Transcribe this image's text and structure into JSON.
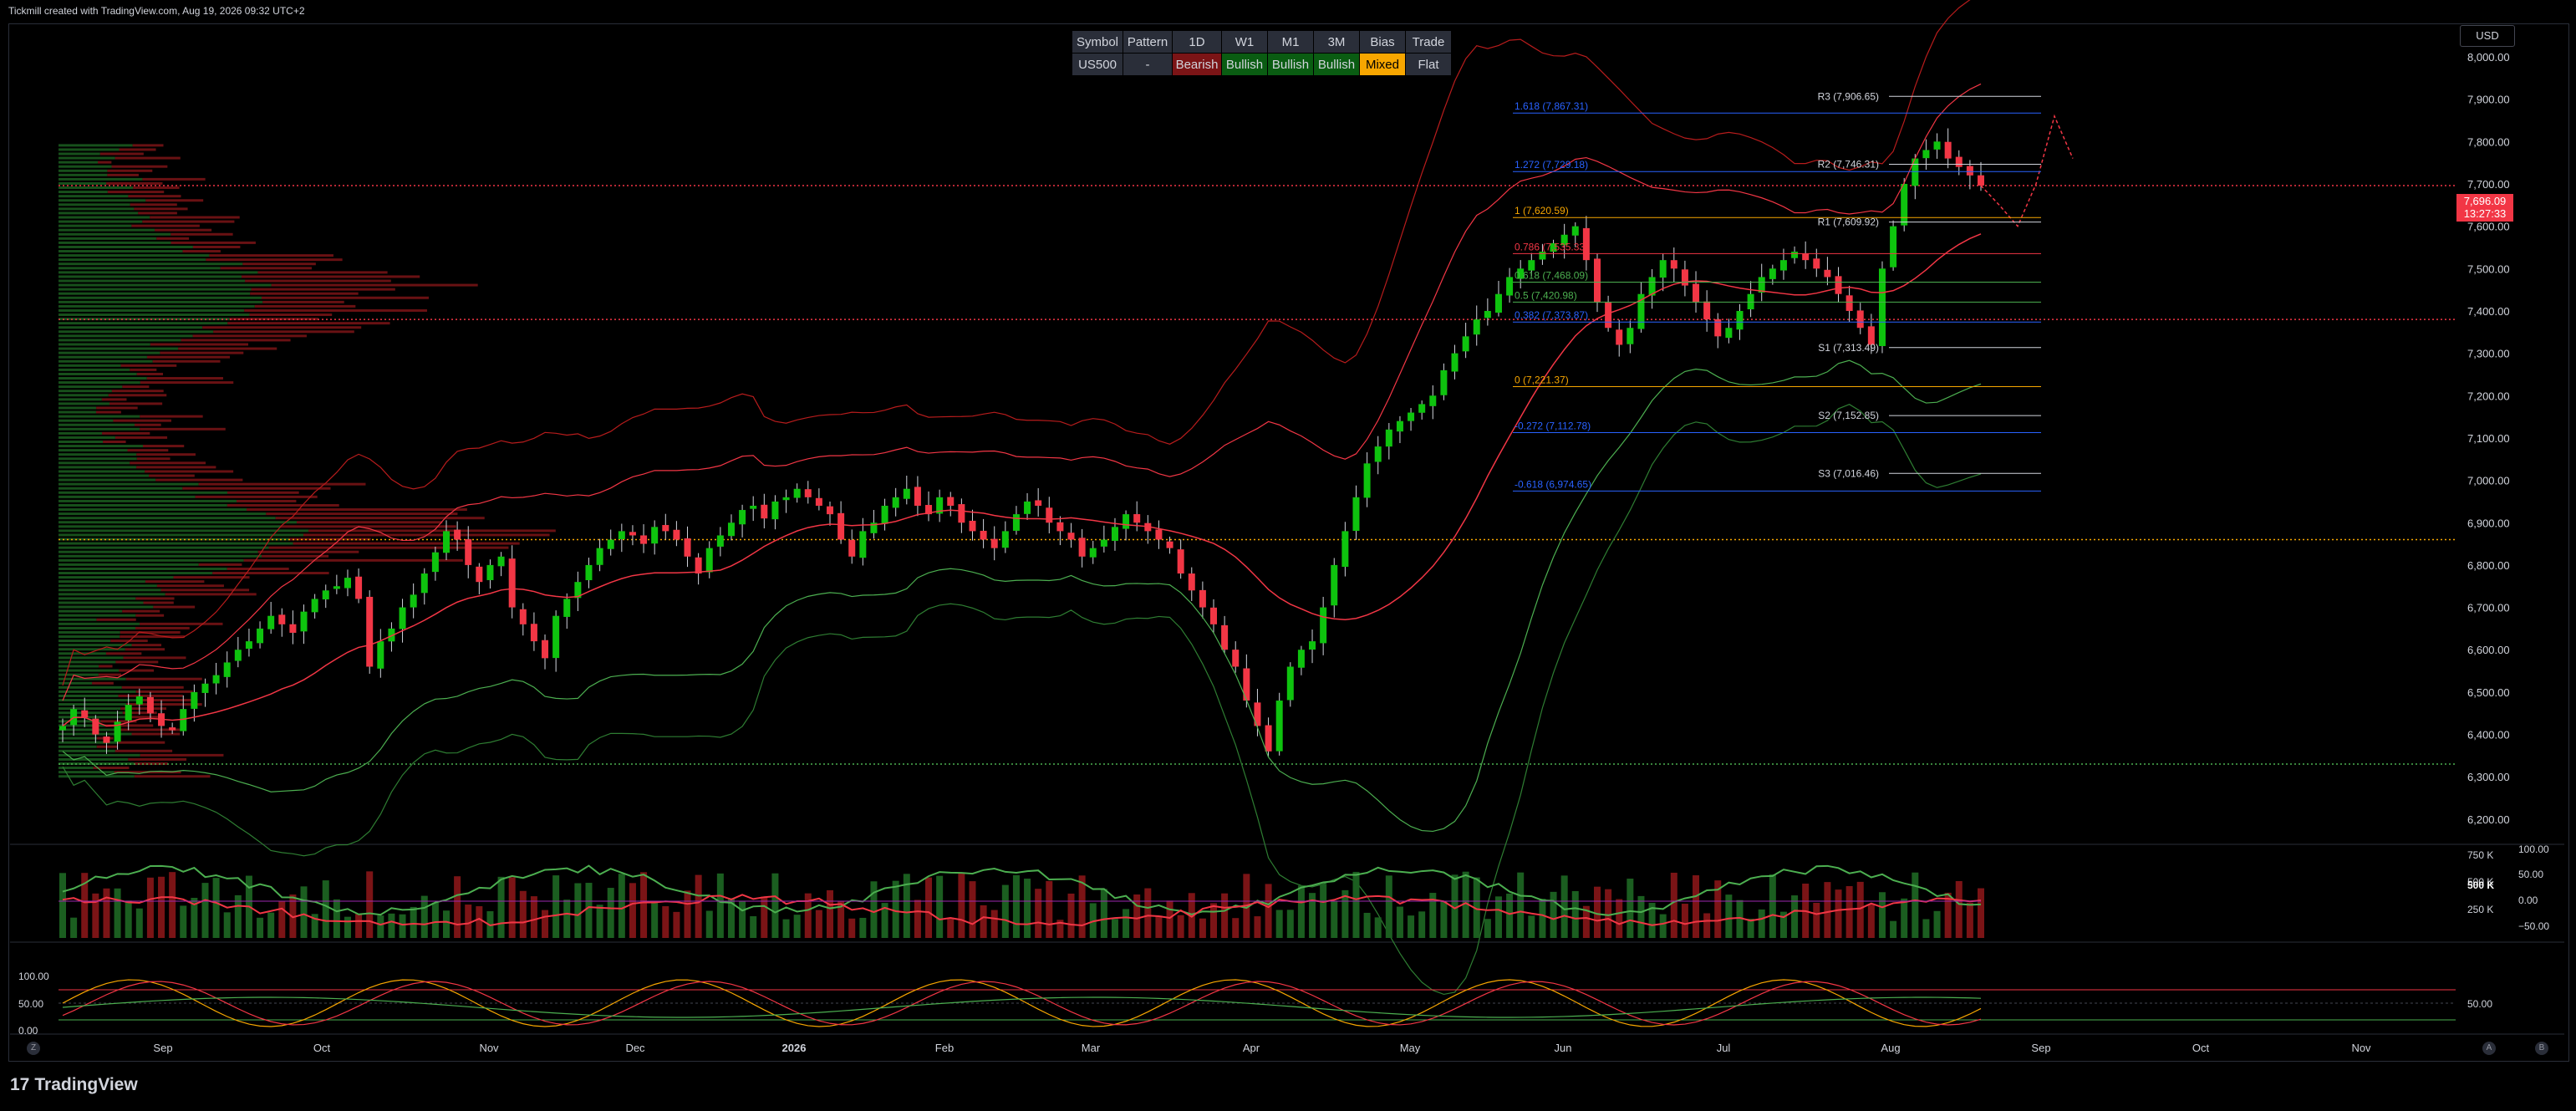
{
  "header": {
    "title": "Tickmill created with TradingView.com, Aug 19, 2026 09:32 UTC+2"
  },
  "currency_button": "USD",
  "footer": {
    "logo": "TradingView",
    "logo_mark": "17"
  },
  "info_table": {
    "headers": [
      "Symbol",
      "Pattern",
      "1D",
      "W1",
      "M1",
      "3M",
      "Bias",
      "Trade"
    ],
    "values": [
      "US500",
      "-",
      "Bearish",
      "Bullish",
      "Bullish",
      "Bullish",
      "Mixed",
      "Flat"
    ],
    "value_colors": [
      "#2a2e39",
      "#2a2e39",
      "#7b1416",
      "#0a5c12",
      "#0a5c12",
      "#0a5c12",
      "#f7a600",
      "#2a2e39"
    ]
  },
  "price_tag": {
    "price": "7,696.09",
    "countdown": "13:27:33"
  },
  "corner_buttons": {
    "left": "Z",
    "right_a": "A",
    "right_b": "B"
  },
  "chart_data": {
    "type": "candlestick",
    "symbol": "US500",
    "price_axis_ticks": [
      "8,000.00",
      "7,900.00",
      "7,800.00",
      "7,700.00",
      "7,600.00",
      "7,500.00",
      "7,400.00",
      "7,300.00",
      "7,200.00",
      "7,100.00",
      "7,000.00",
      "6,900.00",
      "6,800.00",
      "6,700.00",
      "6,600.00",
      "6,500.00",
      "6,400.00",
      "6,300.00",
      "6,200.00"
    ],
    "ylim": [
      6180,
      8000
    ],
    "time_axis_ticks": [
      "Sep",
      "Oct",
      "Nov",
      "Dec",
      "2026",
      "Feb",
      "Mar",
      "Apr",
      "May",
      "Jun",
      "Jul",
      "Aug",
      "Sep",
      "Oct",
      "Nov"
    ],
    "pivot_levels": [
      {
        "label": "R3 (7,906.65)",
        "value": 7906.65
      },
      {
        "label": "R2 (7,746.31)",
        "value": 7746.31
      },
      {
        "label": "R1 (7,609.92)",
        "value": 7609.92
      },
      {
        "label": "S1 (7,313.49)",
        "value": 7313.49
      },
      {
        "label": "S2 (7,152.85)",
        "value": 7152.85
      },
      {
        "label": "S3 (7,016.46)",
        "value": 7016.46
      }
    ],
    "fib_levels": [
      {
        "label": "1.618 (7,867.31)",
        "value": 7867.31,
        "color": "#2962ff"
      },
      {
        "label": "1.272 (7,729.18)",
        "value": 7729.18,
        "color": "#2962ff"
      },
      {
        "label": "1 (7,620.59)",
        "value": 7620.59,
        "color": "#f7a600"
      },
      {
        "label": "0.786 (7,535.33)",
        "value": 7535.33,
        "color": "#f23645"
      },
      {
        "label": "0.618 (7,468.09)",
        "value": 7468.09,
        "color": "#4caf50"
      },
      {
        "label": "0.5 (7,420.98)",
        "value": 7420.98,
        "color": "#4caf50"
      },
      {
        "label": "0.382 (7,373.87)",
        "value": 7373.87,
        "color": "#2962ff"
      },
      {
        "label": "0 (7,221.37)",
        "value": 7221.37,
        "color": "#f7a600"
      },
      {
        "label": "-0.272 (7,112.78)",
        "value": 7112.78,
        "color": "#2962ff"
      },
      {
        "label": "-0.618 (6,974.65)",
        "value": 6974.65,
        "color": "#2962ff"
      }
    ],
    "horizontal_lines": [
      {
        "value": 7696.09,
        "style": "dotted",
        "color": "#f23645"
      },
      {
        "value": 7380,
        "style": "dotted",
        "color": "#f23645"
      },
      {
        "value": 6860,
        "style": "dotted",
        "color": "#f7a600"
      },
      {
        "value": 6330,
        "style": "dotted",
        "color": "#4caf50"
      }
    ],
    "closes": [
      6420,
      6460,
      6440,
      6400,
      6380,
      6430,
      6470,
      6490,
      6450,
      6420,
      6410,
      6460,
      6500,
      6520,
      6540,
      6570,
      6600,
      6620,
      6650,
      6680,
      6660,
      6640,
      6690,
      6720,
      6740,
      6750,
      6770,
      6720,
      6560,
      6620,
      6650,
      6700,
      6730,
      6780,
      6830,
      6880,
      6860,
      6800,
      6760,
      6800,
      6820,
      6700,
      6660,
      6620,
      6580,
      6680,
      6720,
      6760,
      6800,
      6840,
      6860,
      6880,
      6870,
      6850,
      6890,
      6880,
      6860,
      6820,
      6780,
      6840,
      6870,
      6900,
      6930,
      6940,
      6910,
      6950,
      6960,
      6980,
      6960,
      6940,
      6920,
      6860,
      6820,
      6880,
      6900,
      6940,
      6960,
      6980,
      6940,
      6920,
      6960,
      6940,
      6900,
      6880,
      6860,
      6840,
      6880,
      6920,
      6950,
      6940,
      6900,
      6880,
      6860,
      6820,
      6840,
      6860,
      6890,
      6920,
      6900,
      6880,
      6860,
      6840,
      6780,
      6740,
      6700,
      6660,
      6600,
      6560,
      6480,
      6420,
      6360,
      6480,
      6560,
      6600,
      6620,
      6700,
      6800,
      6880,
      6960,
      7040,
      7080,
      7120,
      7140,
      7160,
      7180,
      7200,
      7260,
      7300,
      7340,
      7380,
      7400,
      7440,
      7480,
      7500,
      7520,
      7540,
      7560,
      7580,
      7600,
      7520,
      7420,
      7360,
      7320,
      7360,
      7440,
      7480,
      7520,
      7500,
      7460,
      7420,
      7380,
      7340,
      7360,
      7400,
      7440,
      7480,
      7500,
      7520,
      7540,
      7520,
      7500,
      7480,
      7440,
      7400,
      7360,
      7320,
      7500,
      7600,
      7700,
      7760,
      7780,
      7800,
      7760,
      7740,
      7720,
      7696
    ],
    "projection": [
      7696,
      7650,
      7600,
      7700,
      7860,
      7760
    ],
    "volume_axis_ticks": [
      "750 K",
      "500 K",
      "250 K"
    ],
    "oscillator_axis_ticks": [
      "100.00",
      "50.00",
      "0.00",
      "−50.00"
    ],
    "volume_current_label": "500 K",
    "stoch_axis_ticks": [
      "100.00",
      "50.00",
      "0.00"
    ],
    "stoch_right_label": "50.00"
  }
}
